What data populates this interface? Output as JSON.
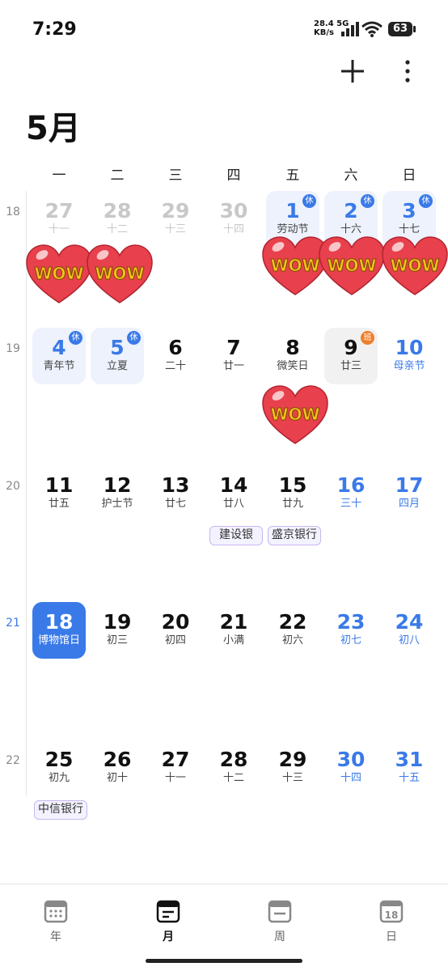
{
  "status": {
    "time": "7:29",
    "speed": "28.4",
    "speed_unit": "KB/s",
    "network": "5G",
    "battery": "63"
  },
  "header": {
    "month_title": "5月"
  },
  "weekdays": [
    "一",
    "二",
    "三",
    "四",
    "五",
    "六",
    "日"
  ],
  "week_numbers": [
    "18",
    "19",
    "20",
    "21",
    "22"
  ],
  "weeks": [
    [
      {
        "day": "27",
        "lunar": "十一"
      },
      {
        "day": "28",
        "lunar": "十二"
      },
      {
        "day": "29",
        "lunar": "十三"
      },
      {
        "day": "30",
        "lunar": "十四"
      },
      {
        "day": "1",
        "lunar": "劳动节",
        "badge": "休"
      },
      {
        "day": "2",
        "lunar": "十六",
        "badge": "休"
      },
      {
        "day": "3",
        "lunar": "十七",
        "badge": "休"
      }
    ],
    [
      {
        "day": "4",
        "lunar": "青年节",
        "badge": "休"
      },
      {
        "day": "5",
        "lunar": "立夏",
        "badge": "休"
      },
      {
        "day": "6",
        "lunar": "二十"
      },
      {
        "day": "7",
        "lunar": "廿一"
      },
      {
        "day": "8",
        "lunar": "微笑日"
      },
      {
        "day": "9",
        "lunar": "廿三",
        "badge": "班"
      },
      {
        "day": "10",
        "lunar": "母亲节"
      }
    ],
    [
      {
        "day": "11",
        "lunar": "廿五"
      },
      {
        "day": "12",
        "lunar": "护士节"
      },
      {
        "day": "13",
        "lunar": "廿七"
      },
      {
        "day": "14",
        "lunar": "廿八"
      },
      {
        "day": "15",
        "lunar": "廿九"
      },
      {
        "day": "16",
        "lunar": "三十"
      },
      {
        "day": "17",
        "lunar": "四月"
      }
    ],
    [
      {
        "day": "18",
        "lunar": "博物馆日"
      },
      {
        "day": "19",
        "lunar": "初三"
      },
      {
        "day": "20",
        "lunar": "初四"
      },
      {
        "day": "21",
        "lunar": "小满"
      },
      {
        "day": "22",
        "lunar": "初六"
      },
      {
        "day": "23",
        "lunar": "初七"
      },
      {
        "day": "24",
        "lunar": "初八"
      }
    ],
    [
      {
        "day": "25",
        "lunar": "初九"
      },
      {
        "day": "26",
        "lunar": "初十"
      },
      {
        "day": "27",
        "lunar": "十一"
      },
      {
        "day": "28",
        "lunar": "十二"
      },
      {
        "day": "29",
        "lunar": "十三"
      },
      {
        "day": "30",
        "lunar": "十四"
      },
      {
        "day": "31",
        "lunar": "十五"
      }
    ]
  ],
  "events": [
    "建设银",
    "盛京银行",
    "中信银行"
  ],
  "sticker": {
    "text": "WOW"
  },
  "bottom_nav": [
    {
      "label": "年",
      "icon": "grid-calendar-icon"
    },
    {
      "label": "月",
      "icon": "list-calendar-icon"
    },
    {
      "label": "周",
      "icon": "week-calendar-icon"
    },
    {
      "label": "日",
      "icon": "day-calendar-icon",
      "icon_text": "18"
    }
  ],
  "colors": {
    "accent": "#3a7ae8",
    "workday_badge": "#f07e2a",
    "holiday_bg": "#edf2fc",
    "sticker_heart": "#e8404c",
    "sticker_text": "#f6c21c"
  }
}
